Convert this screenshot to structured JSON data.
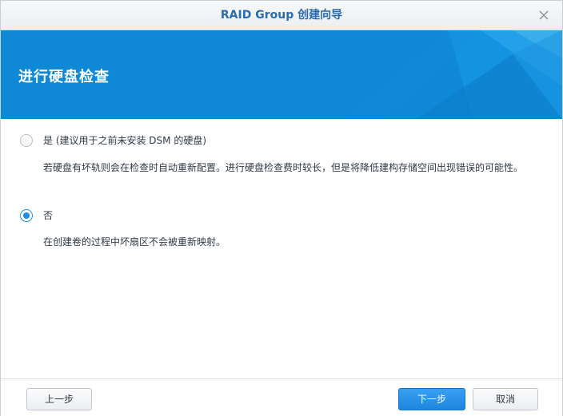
{
  "window": {
    "title": "RAID Group 创建向导"
  },
  "header": {
    "title": "进行硬盘检查"
  },
  "options": [
    {
      "label": "是 (建议用于之前未安装 DSM 的硬盘)",
      "description": "若硬盘有坏轨则会在检查时自动重新配置。进行硬盘检查费时较长，但是将降低建构存储空间出现错误的可能性。",
      "selected": false
    },
    {
      "label": "否",
      "description": "在创建卷的过程中坏扇区不会被重新映射。",
      "selected": true
    }
  ],
  "footer": {
    "back_label": "上一步",
    "next_label": "下一步",
    "cancel_label": "取消"
  },
  "colors": {
    "accent": "#1c8ee8",
    "title_text": "#2a6bb0",
    "banner": "#0f8ad8"
  },
  "icons": {
    "close": "close-icon"
  }
}
